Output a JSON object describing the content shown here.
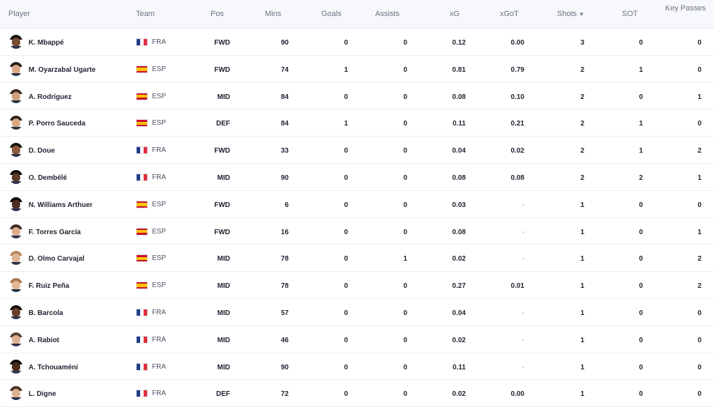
{
  "columns": {
    "player": "Player",
    "team": "Team",
    "pos": "Pos",
    "mins": "Mins",
    "goals": "Goals",
    "assists": "Assists",
    "xg": "xG",
    "xgot": "xGoT",
    "shots": "Shots",
    "sot": "SOT",
    "key_passes": "Key Passes"
  },
  "sort_indicator": "▼",
  "rows": [
    {
      "name": "K. Mbappé",
      "team": "FRA",
      "pos": "FWD",
      "mins": "90",
      "goals": "0",
      "assists": "0",
      "xg": "0.12",
      "xgot": "0.00",
      "shots": "3",
      "sot": "0",
      "kp": "0",
      "skin": "#7a4a2e",
      "hair": "#1b1511"
    },
    {
      "name": "M. Oyarzabal Ugarte",
      "team": "ESP",
      "pos": "FWD",
      "mins": "74",
      "goals": "1",
      "assists": "0",
      "xg": "0.81",
      "xgot": "0.79",
      "shots": "2",
      "sot": "1",
      "kp": "0",
      "skin": "#d9a785",
      "hair": "#2a1d16"
    },
    {
      "name": "A. Rodríguez",
      "team": "ESP",
      "pos": "MID",
      "mins": "84",
      "goals": "0",
      "assists": "0",
      "xg": "0.08",
      "xgot": "0.10",
      "shots": "2",
      "sot": "0",
      "kp": "1",
      "skin": "#d2a07e",
      "hair": "#3a2a20"
    },
    {
      "name": "P. Porro Sauceda",
      "team": "ESP",
      "pos": "DEF",
      "mins": "84",
      "goals": "1",
      "assists": "0",
      "xg": "0.11",
      "xgot": "0.21",
      "shots": "2",
      "sot": "1",
      "kp": "0",
      "skin": "#d8a883",
      "hair": "#2e231c"
    },
    {
      "name": "D. Doue",
      "team": "FRA",
      "pos": "FWD",
      "mins": "33",
      "goals": "0",
      "assists": "0",
      "xg": "0.04",
      "xgot": "0.02",
      "shots": "2",
      "sot": "1",
      "kp": "2",
      "skin": "#8d5a3a",
      "hair": "#1c1410"
    },
    {
      "name": "O. Dembélé",
      "team": "FRA",
      "pos": "MID",
      "mins": "90",
      "goals": "0",
      "assists": "0",
      "xg": "0.08",
      "xgot": "0.08",
      "shots": "2",
      "sot": "2",
      "kp": "1",
      "skin": "#5e3a26",
      "hair": "#120d0a"
    },
    {
      "name": "N. Williams Arthuer",
      "team": "ESP",
      "pos": "FWD",
      "mins": "6",
      "goals": "0",
      "assists": "0",
      "xg": "0.03",
      "xgot": "-",
      "shots": "1",
      "sot": "0",
      "kp": "0",
      "skin": "#4d2f1f",
      "hair": "#0f0b09"
    },
    {
      "name": "F. Torres García",
      "team": "ESP",
      "pos": "FWD",
      "mins": "16",
      "goals": "0",
      "assists": "0",
      "xg": "0.08",
      "xgot": "-",
      "shots": "1",
      "sot": "0",
      "kp": "1",
      "skin": "#dcae8c",
      "hair": "#3a2b21"
    },
    {
      "name": "D. Olmo Carvajal",
      "team": "ESP",
      "pos": "MID",
      "mins": "78",
      "goals": "0",
      "assists": "1",
      "xg": "0.02",
      "xgot": "-",
      "shots": "1",
      "sot": "0",
      "kp": "2",
      "skin": "#e0b596",
      "hair": "#b58a5c"
    },
    {
      "name": "F. Ruiz Peña",
      "team": "ESP",
      "pos": "MID",
      "mins": "78",
      "goals": "0",
      "assists": "0",
      "xg": "0.27",
      "xgot": "0.01",
      "shots": "1",
      "sot": "0",
      "kp": "2",
      "skin": "#e2b798",
      "hair": "#a8774d"
    },
    {
      "name": "B. Barcola",
      "team": "FRA",
      "pos": "MID",
      "mins": "57",
      "goals": "0",
      "assists": "0",
      "xg": "0.04",
      "xgot": "-",
      "shots": "1",
      "sot": "0",
      "kp": "0",
      "skin": "#6b4129",
      "hair": "#151010"
    },
    {
      "name": "A. Rabiot",
      "team": "FRA",
      "pos": "MID",
      "mins": "46",
      "goals": "0",
      "assists": "0",
      "xg": "0.02",
      "xgot": "-",
      "shots": "1",
      "sot": "0",
      "kp": "0",
      "skin": "#deb08f",
      "hair": "#5a4130"
    },
    {
      "name": "A. Tchouaméni",
      "team": "FRA",
      "pos": "MID",
      "mins": "90",
      "goals": "0",
      "assists": "0",
      "xg": "0.11",
      "xgot": "-",
      "shots": "1",
      "sot": "0",
      "kp": "0",
      "skin": "#4a2c1c",
      "hair": "#0d0a08"
    },
    {
      "name": "L. Digne",
      "team": "FRA",
      "pos": "DEF",
      "mins": "72",
      "goals": "0",
      "assists": "0",
      "xg": "0.02",
      "xgot": "0.00",
      "shots": "1",
      "sot": "0",
      "kp": "0",
      "skin": "#dfb293",
      "hair": "#4a3526"
    }
  ]
}
